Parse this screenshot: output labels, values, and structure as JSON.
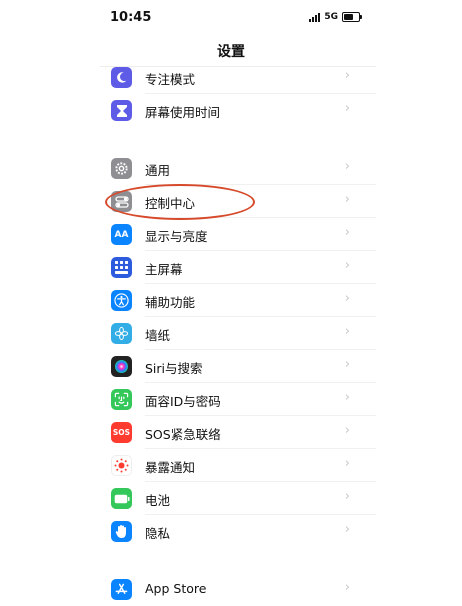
{
  "status_bar": {
    "time": "10:45",
    "network": "5G"
  },
  "nav": {
    "title": "设置"
  },
  "items": [
    {
      "label": "专注模式",
      "icon": "moon-icon",
      "color": "#5e5ce6"
    },
    {
      "label": "屏幕使用时间",
      "icon": "hourglass-icon",
      "color": "#5e5ce6"
    },
    {
      "label": "通用",
      "icon": "gear-icon",
      "color": "#8e8e93"
    },
    {
      "label": "控制中心",
      "icon": "toggles-icon",
      "color": "#8e8e93"
    },
    {
      "label": "显示与亮度",
      "icon": "text-size-icon",
      "color": "#0a84ff",
      "icon_text": "AA"
    },
    {
      "label": "主屏幕",
      "icon": "home-grid-icon",
      "color": "#2c5bde"
    },
    {
      "label": "辅助功能",
      "icon": "accessibility-icon",
      "color": "#0a84ff"
    },
    {
      "label": "墙纸",
      "icon": "flower-icon",
      "color": "#32ade6"
    },
    {
      "label": "Siri与搜索",
      "icon": "siri-icon",
      "color": "#222222"
    },
    {
      "label": "面容ID与密码",
      "icon": "face-id-icon",
      "color": "#34c759"
    },
    {
      "label": "SOS紧急联络",
      "icon": "sos-icon",
      "color": "#ff3b30",
      "icon_text": "SOS"
    },
    {
      "label": "暴露通知",
      "icon": "exposure-icon",
      "color": "#ffffff"
    },
    {
      "label": "电池",
      "icon": "battery-icon",
      "color": "#34c759"
    },
    {
      "label": "隐私",
      "icon": "hand-icon",
      "color": "#0a84ff"
    },
    {
      "label": "App Store",
      "icon": "app-store-icon",
      "color": "#0a84ff"
    }
  ],
  "highlight_color": "#d64a2b",
  "chevron": "›"
}
